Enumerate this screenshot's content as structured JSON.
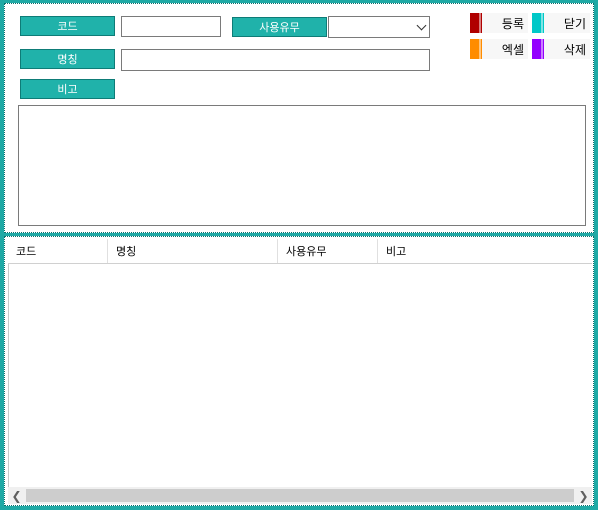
{
  "form": {
    "code_label": "코드",
    "name_label": "명칭",
    "use_label": "사용유무",
    "remark_label": "비고",
    "code_value": "",
    "name_value": "",
    "use_value": "",
    "remark_value": ""
  },
  "toolbar": {
    "register_label": "등록",
    "close_label": "닫기",
    "excel_label": "엑셀",
    "delete_label": "삭제",
    "colors": {
      "register": "#b00000",
      "close": "#00c8c8",
      "excel": "#ff8c00",
      "delete": "#9400ff"
    }
  },
  "grid": {
    "columns": [
      "코드",
      "명칭",
      "사용유무",
      "비고"
    ],
    "rows": []
  }
}
